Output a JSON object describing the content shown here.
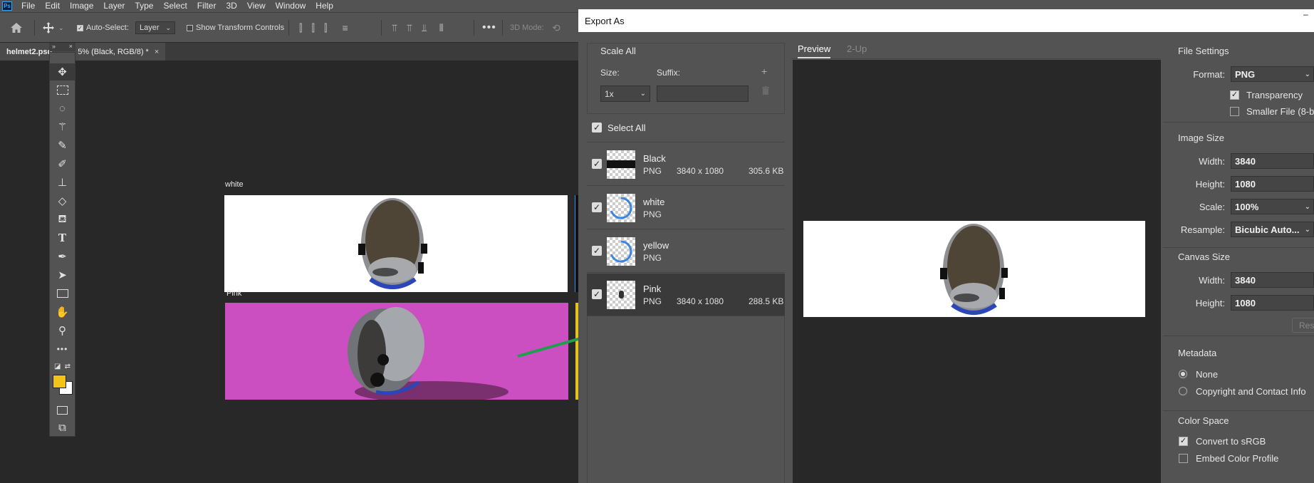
{
  "app": {
    "logo": "Ps"
  },
  "menu": [
    "File",
    "Edit",
    "Image",
    "Layer",
    "Type",
    "Select",
    "Filter",
    "3D",
    "View",
    "Window",
    "Help"
  ],
  "options_bar": {
    "auto_select_label": "Auto-Select:",
    "auto_select_checked": true,
    "auto_select_target": "Layer",
    "show_transform_label": "Show Transform Controls",
    "mode_3d_label": "3D Mode:"
  },
  "document_tabs": {
    "title": "helmet2.psd @ 25% (Black, RGB/8) *",
    "visible_left": "helmet2.psd",
    "visible_right": "5% (Black, RGB/8) *",
    "close": "×"
  },
  "canvas": {
    "artboards": [
      {
        "label": "white",
        "bg": "#ffffff"
      },
      {
        "label": "Pink",
        "bg": "#cc4fc2"
      }
    ],
    "foreground_color": "#f0c419",
    "background_color": "#ffffff"
  },
  "dialog": {
    "title": "Export As",
    "scale_all": {
      "heading": "Scale All",
      "size_label": "Size:",
      "suffix_label": "Suffix:",
      "size_value": "1x",
      "suffix_value": "",
      "add": "+",
      "delete_icon": "trash-icon"
    },
    "select_all_label": "Select All",
    "assets": [
      {
        "name": "Black",
        "format": "PNG",
        "dimensions": "3840 x 1080",
        "size": "305.6 KB",
        "checked": true
      },
      {
        "name": "white",
        "format": "PNG",
        "dimensions": "",
        "size": "",
        "checked": true
      },
      {
        "name": "yellow",
        "format": "PNG",
        "dimensions": "",
        "size": "",
        "checked": true
      },
      {
        "name": "Pink",
        "format": "PNG",
        "dimensions": "3840 x 1080",
        "size": "288.5 KB",
        "checked": true
      }
    ],
    "preview_tabs": [
      "Preview",
      "2-Up"
    ],
    "file_settings": {
      "heading": "File Settings",
      "format_label": "Format:",
      "format_value": "PNG",
      "transparency_label": "Transparency",
      "transparency_checked": true,
      "smaller_file_label": "Smaller File (8-bi",
      "smaller_file_checked": false
    },
    "image_size": {
      "heading": "Image Size",
      "width_label": "Width:",
      "width_value": "3840",
      "height_label": "Height:",
      "height_value": "1080",
      "scale_label": "Scale:",
      "scale_value": "100%",
      "resample_label": "Resample:",
      "resample_value": "Bicubic Auto..."
    },
    "canvas_size": {
      "heading": "Canvas Size",
      "width_label": "Width:",
      "width_value": "3840",
      "height_label": "Height:",
      "height_value": "1080",
      "reset_label": "Res"
    },
    "metadata": {
      "heading": "Metadata",
      "options": [
        "None",
        "Copyright and Contact Info"
      ],
      "selected": "None"
    },
    "color_space": {
      "heading": "Color Space",
      "convert_label": "Convert to sRGB",
      "convert_checked": true,
      "embed_label": "Embed Color Profile",
      "embed_checked": false
    }
  }
}
